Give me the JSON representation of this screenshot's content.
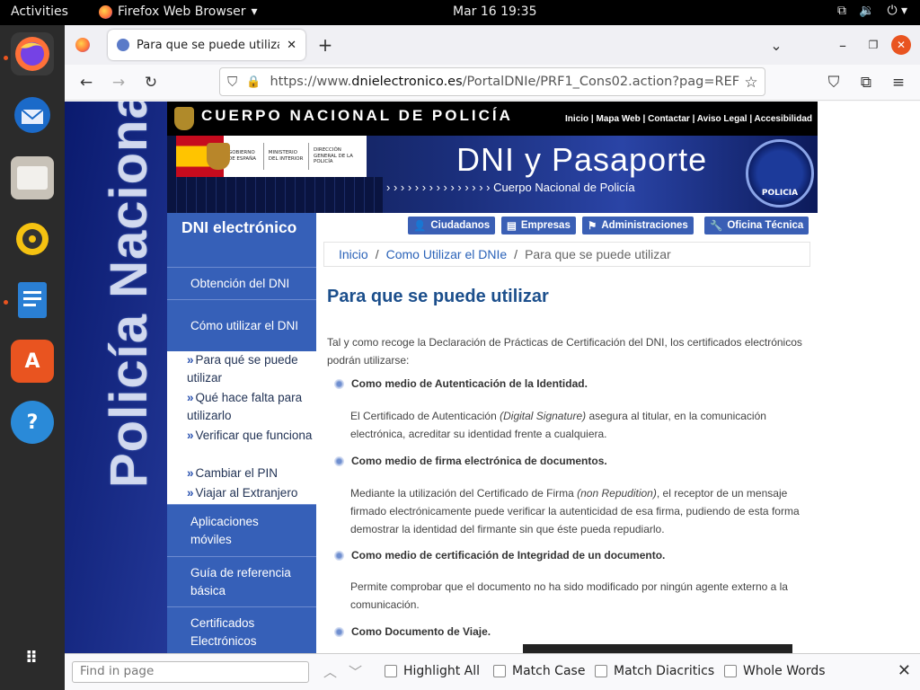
{
  "topbar": {
    "activities": "Activities",
    "app_name": "Firefox Web Browser",
    "clock": "Mar 16  19:35"
  },
  "dock": {
    "items": [
      "Firefox",
      "Thunderbird",
      "Files",
      "Rhythmbox",
      "LibreOffice Writer",
      "Ubuntu Software",
      "Help",
      "Show Applications"
    ]
  },
  "browser": {
    "tab_title": "Para que se puede utiliza",
    "url_prefix": "https://www.",
    "url_host": "dnielectronico.es",
    "url_path": "/PortalDNIe/PRF1_Cons02.action?pag=REF"
  },
  "site": {
    "vertical_brand": "Policía Nacional",
    "top_name": "CUERPO NACIONAL DE POLICÍA",
    "top_links": "Inicio | Mapa Web | Contactar | Aviso Legal | Accesibilidad",
    "gov_text": "GOBIERNO DE ESPAÑA",
    "ministry_text": "MINISTERIO DEL INTERIOR",
    "direction_text": "DIRECCIÓN GENERAL DE LA POLICÍA",
    "banner_title": "DNI y Pasaporte",
    "banner_sub": "› › › › › › › › › › › › › › ›  Cuerpo Nacional de Policía",
    "seal_text": "POLICIA",
    "pills": [
      "Ciudadanos",
      "Empresas",
      "Administraciones",
      "Oficina Técnica"
    ],
    "breadcrumb": {
      "home": "Inicio",
      "sep": "/",
      "section": "Como Utilizar el DNIe",
      "current": "Para que se puede utilizar"
    },
    "menu": {
      "header": "DNI electrónico",
      "items": [
        "Obtención del DNI",
        "Cómo utilizar el DNI",
        "Aplicaciones móviles",
        "Guía de referencia básica",
        "Certificados Electrónicos"
      ],
      "subitems": [
        "Para qué se puede utilizar",
        "Qué hace falta para utilizarlo",
        "Verificar que funciona",
        "Cambiar el PIN",
        "Viajar al Extranjero"
      ],
      "sub_arrow": "»"
    },
    "heading": "Para que se puede utilizar",
    "intro": "Tal y como recoge la Declaración de Prácticas de Certificación del DNI, los certificados electrónicos podrán utilizarse:",
    "sections": [
      {
        "title": "Como medio de Autenticación de la Identidad.",
        "text_a": "El Certificado de Autenticación ",
        "text_it": "(Digital Signature)",
        "text_b": " asegura al titular, en la comunicación electrónica, acreditar su identidad frente a cualquiera."
      },
      {
        "title": "Como medio de firma electrónica de documentos.",
        "text_a": "Mediante la utilización del Certificado de Firma ",
        "text_it": "(non Repudition)",
        "text_b": ", el receptor de un mensaje firmado electrónicamente puede verificar la autenticidad de esa firma, pudiendo de esta forma demostrar la identidad del firmante sin que éste pueda repudiarlo."
      },
      {
        "title": "Como medio de certificación de Integridad de un documento.",
        "text_a": "Permite comprobar que el documento no ha sido modificado por ningún agente externo a la comunicación.",
        "text_it": "",
        "text_b": ""
      },
      {
        "title": "Como Documento de Viaje.",
        "text_a": "",
        "text_it": "",
        "text_b": ""
      }
    ]
  },
  "findbar": {
    "placeholder": "Find in page",
    "options": [
      "Highlight All",
      "Match Case",
      "Match Diacritics",
      "Whole Words"
    ]
  }
}
